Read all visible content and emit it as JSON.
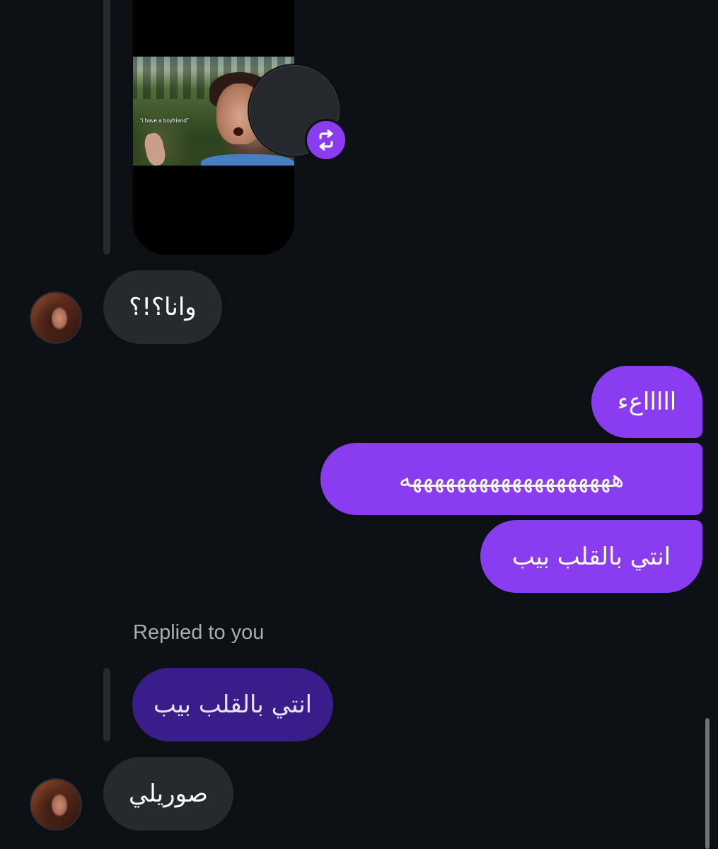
{
  "thread": {
    "shared_reel": {
      "caption": "“i have a boyfriend”",
      "badge_icon": "repost-icon"
    },
    "messages": [
      {
        "side": "incoming",
        "text": "وانا؟!؟"
      },
      {
        "side": "outgoing",
        "text": "اااااعء"
      },
      {
        "side": "outgoing",
        "text": "هههههههههههههههههههه"
      },
      {
        "side": "outgoing",
        "text": "انتي بالقلب بيب"
      },
      {
        "side": "incoming",
        "text": "صوريلي"
      }
    ],
    "reply_context": {
      "label": "Replied to you",
      "quoted_text": "انتي بالقلب بيب"
    }
  },
  "colors": {
    "background": "#0c1014",
    "incoming_bubble": "#262a2f",
    "outgoing_bubble": "#8a3cf0",
    "quoted_bubble": "#3b1d8a",
    "secondary_text": "#a8adb3"
  }
}
